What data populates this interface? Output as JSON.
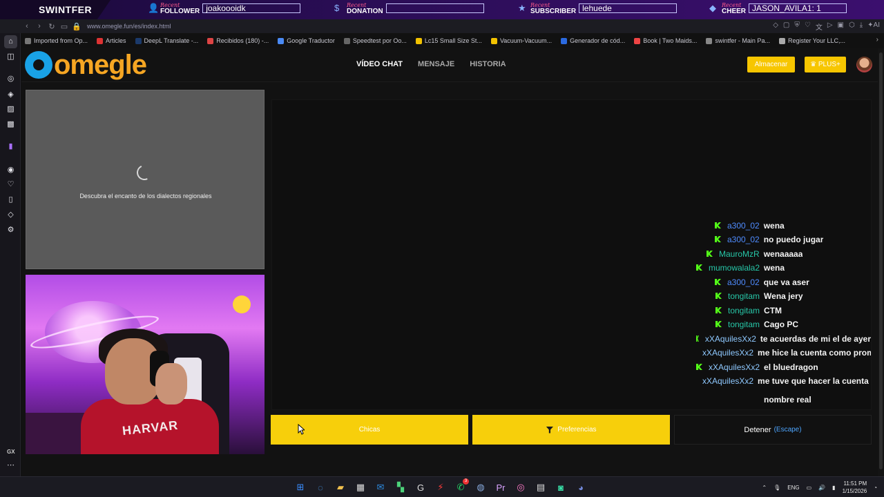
{
  "overlay": {
    "brand": "SWINTFER",
    "recent_label": "Recent",
    "follower": {
      "kind": "FOLLOWER",
      "value": "joakoooidk"
    },
    "donation": {
      "kind": "DONATION",
      "value": ""
    },
    "subscriber": {
      "kind": "SUBSCRIBER",
      "value": "lehuede"
    },
    "cheer": {
      "kind": "CHEER",
      "value": "JASON_AVILA1: 1"
    }
  },
  "browser": {
    "url": "www.omegle.fun/es/index.html",
    "ai_label": "AI",
    "bookmarks": [
      {
        "label": "Imported from Op...",
        "color": "#777"
      },
      {
        "label": "Articles",
        "color": "#d33"
      },
      {
        "label": "DeepL Translate -...",
        "color": "#1b3a6b"
      },
      {
        "label": "Recibidos (180) -...",
        "color": "#d44"
      },
      {
        "label": "Google Traductor",
        "color": "#4a8af4"
      },
      {
        "label": "Speedtest por Oo...",
        "color": "#666"
      },
      {
        "label": "Lc15 Small Size St...",
        "color": "#f2c200"
      },
      {
        "label": "Vacuum-Vacuum...",
        "color": "#f2c200"
      },
      {
        "label": "Generador de cód...",
        "color": "#2b6ae0"
      },
      {
        "label": "Book | Two Maids...",
        "color": "#e44"
      },
      {
        "label": "swintfer - Main Pa...",
        "color": "#888"
      },
      {
        "label": "Register Your LLC,...",
        "color": "#aaa"
      }
    ]
  },
  "sidebar": {
    "gx_label": "GX"
  },
  "site": {
    "logo_text": "omegle",
    "nav": [
      {
        "label": "VÍDEO CHAT",
        "active": true
      },
      {
        "label": "MENSAJE",
        "active": false
      },
      {
        "label": "HISTORIA",
        "active": false
      }
    ],
    "store_label": "Almacenar",
    "plus_label": "♛ PLUS+",
    "stranger_hint": "Descubra el encanto de los dialectos regionales",
    "hoodie_text": "HARVAR",
    "buttons": {
      "chicas": "Chicas",
      "preferences": "Preferencias",
      "stop": "Detener",
      "stop_key": "(Escape)"
    }
  },
  "chat": {
    "messages": [
      {
        "user": "a300_02",
        "color": "#4f8cff",
        "text": "wena"
      },
      {
        "user": "a300_02",
        "color": "#4f8cff",
        "text": "no puedo jugar"
      },
      {
        "user": "MauroMzR",
        "color": "#27c7a8",
        "text": "wenaaaaa"
      },
      {
        "user": "mumowalala2",
        "color": "#27c7a8",
        "text": "wena"
      },
      {
        "user": "a300_02",
        "color": "#4f8cff",
        "text": "que va aser"
      },
      {
        "user": "tongitam",
        "color": "#27c7a8",
        "text": "Wena jery"
      },
      {
        "user": "tongitam",
        "color": "#27c7a8",
        "text": "CTM"
      },
      {
        "user": "tongitam",
        "color": "#27c7a8",
        "text": "Cago PC"
      },
      {
        "user": "xXAquilesXx2",
        "color": "#8fc9ff",
        "text": "te acuerdas de mi el de ayer"
      },
      {
        "user": "xXAquilesXx2",
        "color": "#8fc9ff",
        "text": "me hice la cuenta como prome"
      },
      {
        "user": "xXAquilesXx2",
        "color": "#8fc9ff",
        "text": "el bluedragon"
      },
      {
        "user": "xXAquilesXx2",
        "color": "#8fc9ff",
        "text": "me tuve que hacer la cuenta co"
      }
    ],
    "continuation": "nombre real"
  },
  "taskbar": {
    "whatsapp_badge": "3",
    "lang": "ENG",
    "time": "11:51 PM",
    "date": "1/15/2026"
  },
  "colors": {
    "accent_yellow": "#f7cf0b",
    "kick_green": "#53fc18"
  }
}
